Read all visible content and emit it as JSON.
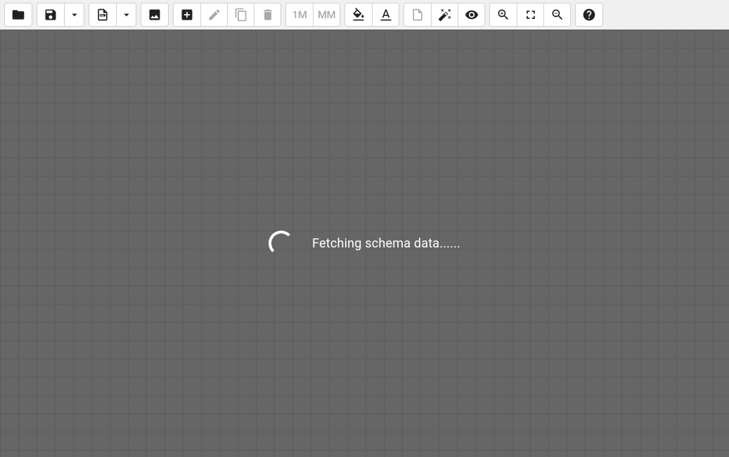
{
  "toolbar": {
    "open_label": "Open",
    "save_label": "Save",
    "save_dropdown_label": "Save options",
    "sql_label": "SQL file",
    "sql_dropdown_label": "SQL options",
    "image_label": "Image",
    "add_label": "Add",
    "edit_label": "Edit",
    "copy_label": "Copy",
    "delete_label": "Delete",
    "one_many_label": "1M",
    "many_many_label": "MM",
    "fill_color_label": "Fill color",
    "text_color_label": "Text color",
    "note_label": "Note",
    "auto_align_label": "Auto align",
    "show_label": "Show details",
    "zoom_in_label": "Zoom in",
    "zoom_fit_label": "Zoom to fit",
    "zoom_out_label": "Zoom out",
    "help_label": "Help"
  },
  "canvas": {
    "loading_text": "Fetching schema data......"
  }
}
